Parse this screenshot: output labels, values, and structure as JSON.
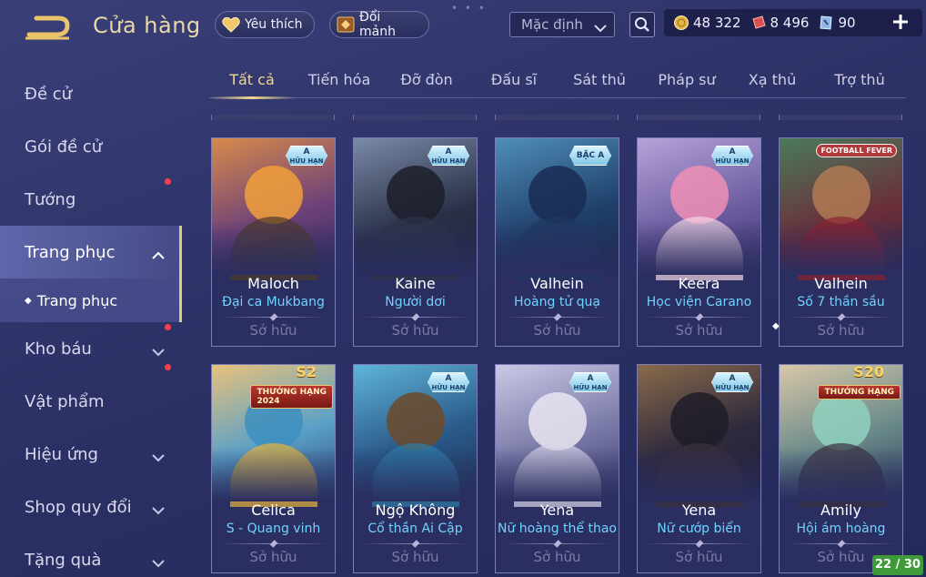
{
  "header": {
    "title": "Cửa hàng",
    "favorites_label": "Yêu thích",
    "exchange_label": "Đổi mảnh",
    "sort_value": "Mặc định"
  },
  "currency": {
    "gold": "48 322",
    "vouchers": "8 496",
    "tickets": "90"
  },
  "sidebar": {
    "items": [
      {
        "label": "Đề cử"
      },
      {
        "label": "Gói đề cử"
      },
      {
        "label": "Tướng"
      },
      {
        "label": "Trang phục"
      },
      {
        "label": "Kho báu"
      },
      {
        "label": "Vật phẩm"
      },
      {
        "label": "Hiệu ứng"
      },
      {
        "label": "Shop quy đổi"
      },
      {
        "label": "Tặng quà"
      }
    ],
    "sub_item": "Trang phục"
  },
  "tabs": [
    "Tất cả",
    "Tiến hóa",
    "Đỡ đòn",
    "Đấu sĩ",
    "Sát thủ",
    "Pháp sư",
    "Xạ thủ",
    "Trợ thủ"
  ],
  "cards": [
    {
      "hero": "Maloch",
      "skin": "Đại ca Mukbang",
      "status": "Sở hữu",
      "badge_tier": "A",
      "badge_text": "HỮU HẠN"
    },
    {
      "hero": "Kaine",
      "skin": "Người dơi",
      "status": "Sở hữu",
      "badge_tier": "A",
      "badge_text": "HỮU HẠN"
    },
    {
      "hero": "Valhein",
      "skin": "Hoàng tử quạ",
      "status": "Sở hữu",
      "badge_tier": "BẬC A",
      "badge_text": ""
    },
    {
      "hero": "Keera",
      "skin": "Học viện Carano",
      "status": "Sở hữu",
      "badge_tier": "A",
      "badge_text": "HỮU HẠN"
    },
    {
      "hero": "Valhein",
      "skin": "Số 7 thần sầu",
      "status": "Sở hữu",
      "event_badge": "FOOTBALL FEVER"
    },
    {
      "hero": "Celica",
      "skin": "S - Quang vinh",
      "status": "Sở hữu",
      "rank_top": "S2",
      "rank_label": "THƯỞNG HẠNG",
      "rank_year": "2024"
    },
    {
      "hero": "Ngộ Không",
      "skin": "Cổ thần Ai Cập",
      "status": "Sở hữu",
      "badge_tier": "A",
      "badge_text": "HỮU HẠN"
    },
    {
      "hero": "Yena",
      "skin": "Nữ hoàng thể thao",
      "status": "Sở hữu",
      "badge_tier": "A",
      "badge_text": "HỮU HẠN"
    },
    {
      "hero": "Yena",
      "skin": "Nữ cướp biển",
      "status": "Sở hữu",
      "badge_tier": "A",
      "badge_text": "HỮU HẠN"
    },
    {
      "hero": "Amily",
      "skin": "Hội ám hoàng",
      "status": "Sở hữu",
      "rank_top": "S20",
      "rank_label": "THƯỞNG HẠNG"
    }
  ],
  "page_counter": "22 / 30",
  "colors": {
    "accent_gold": "#f0d98f",
    "skin_name": "#6fd3ff",
    "notification_dot": "#ff3b4e",
    "counter_green": "#3f9a3a"
  },
  "icons": [
    "back-arrow-icon",
    "heart-icon",
    "shard-exchange-icon",
    "chevron-down-icon",
    "search-icon",
    "gold-coin-icon",
    "voucher-icon",
    "ticket-icon",
    "plus-icon"
  ]
}
